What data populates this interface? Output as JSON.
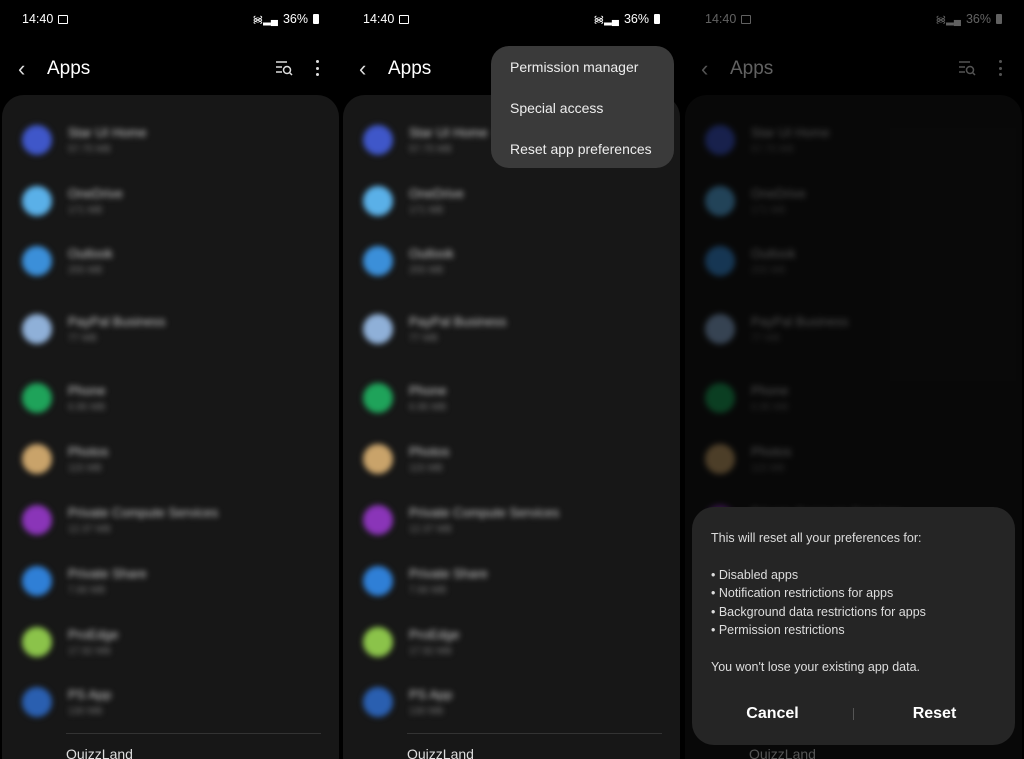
{
  "status_bar": {
    "time": "14:40",
    "battery": "36%"
  },
  "header": {
    "title": "Apps"
  },
  "apps": [
    {
      "name": "Star UI Home",
      "sub": "57.75 MB",
      "color": "#3f57c9"
    },
    {
      "name": "OneDrive",
      "sub": "171 MB",
      "color": "#5ab0e8"
    },
    {
      "name": "Outlook",
      "sub": "255 MB",
      "color": "#3b8fd9"
    },
    {
      "name": "PayPal Business",
      "sub": "77 MB",
      "color": "#8fb0d8"
    },
    {
      "name": "Phone",
      "sub": "6.95 MB",
      "color": "#1fa35a"
    },
    {
      "name": "Photos",
      "sub": "115 MB",
      "color": "#c9a36a"
    },
    {
      "name": "Private Compute Services",
      "sub": "12.37 MB",
      "color": "#8a35b8"
    },
    {
      "name": "Private Share",
      "sub": "7.66 MB",
      "color": "#2f7fd6"
    },
    {
      "name": "ProEdge",
      "sub": "17.92 MB",
      "color": "#8bc34a"
    },
    {
      "name": "PS App",
      "sub": "130 MB",
      "color": "#2a5fb0"
    }
  ],
  "last_app": "QuizzLand",
  "menu": {
    "items": [
      "Permission manager",
      "Special access",
      "Reset app preferences"
    ]
  },
  "dialog": {
    "intro": "This will reset all your preferences for:",
    "bullets": [
      "• Disabled apps",
      "• Notification restrictions for apps",
      "• Background data restrictions for apps",
      "• Permission restrictions"
    ],
    "note": "You won't lose your existing app data.",
    "cancel": "Cancel",
    "reset": "Reset"
  }
}
